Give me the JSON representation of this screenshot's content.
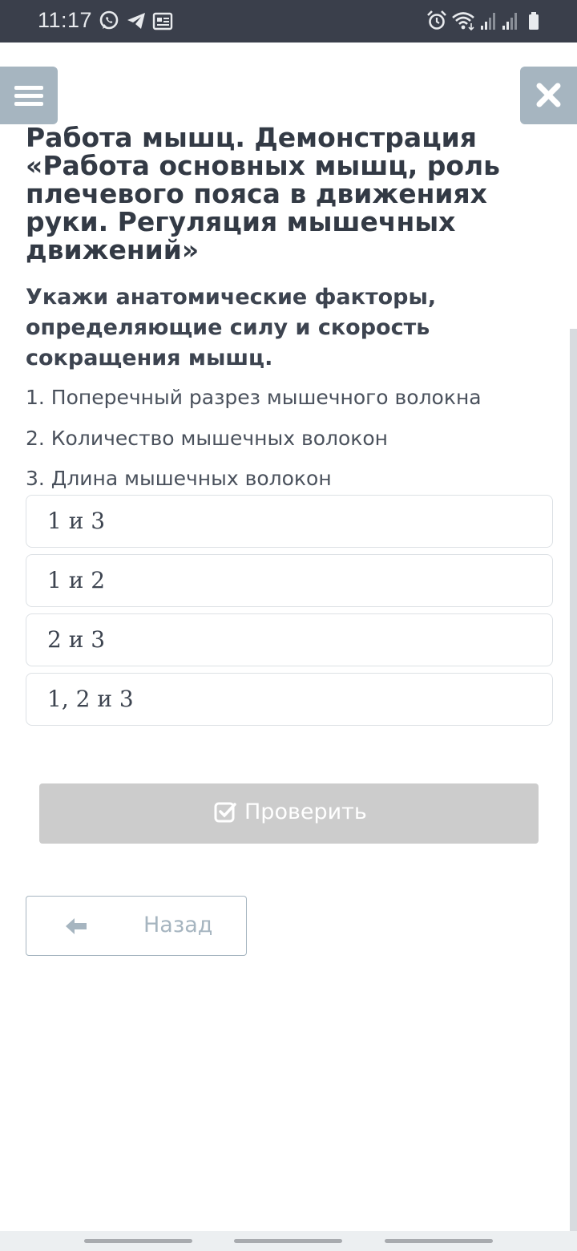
{
  "status": {
    "time": "11:17",
    "icons": [
      "whatsapp-icon",
      "telegram-icon",
      "news-icon",
      "alarm-icon",
      "wifi-icon",
      "signal-icon",
      "signal-icon",
      "battery-icon"
    ]
  },
  "header": {
    "menu_icon": "hamburger-menu-icon",
    "close_icon": "close-icon"
  },
  "lesson": {
    "title": "Работа мышц. Демонстрация «Работа основных мышц, роль плечевого пояса в движениях руки. Регуляция мышечных движений»"
  },
  "task": {
    "question": "Укажи анатомические факторы, определяющие силу и скорость сокращения мышц.",
    "items": [
      "1. Поперечный разрез мышечного волокна",
      "2. Количество мышечных волокон",
      "3. Длина мышечных волокон"
    ],
    "options": [
      "1 и 3",
      "1 и 2",
      "2 и 3",
      "1, 2 и 3"
    ]
  },
  "actions": {
    "check_label": "Проверить",
    "back_label": "Назад"
  },
  "colors": {
    "status_bar": "#3a3f4b",
    "accent_gray_blue": "#a6b5c0",
    "disabled_button": "#cccccc"
  }
}
